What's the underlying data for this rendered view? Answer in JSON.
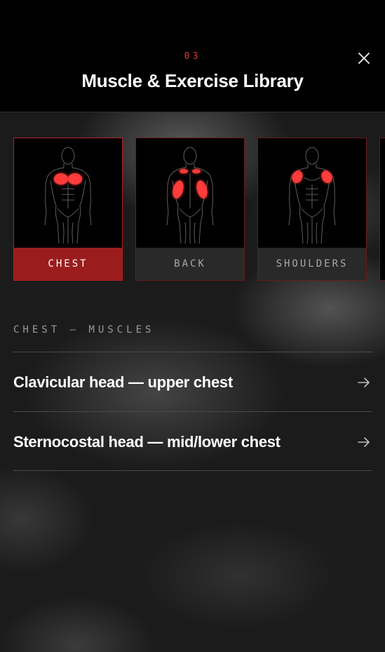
{
  "header": {
    "step": "03",
    "title": "Muscle & Exercise Library",
    "close_icon": "close-icon"
  },
  "muscle_groups": [
    {
      "label": "CHEST",
      "active": true,
      "highlight": "chest"
    },
    {
      "label": "BACK",
      "active": false,
      "highlight": "back"
    },
    {
      "label": "SHOULDERS",
      "active": false,
      "highlight": "shoulders"
    }
  ],
  "section": {
    "label": "CHEST — MUSCLES"
  },
  "muscles": [
    {
      "label": "Clavicular head — upper chest",
      "icon": "arrow-right-icon"
    },
    {
      "label": "Sternocostal head — mid/lower chest",
      "icon": "arrow-right-icon"
    }
  ],
  "colors": {
    "accent": "#d43a3a",
    "active_tab": "#9b1c1c",
    "highlight": "#ff3b3b"
  }
}
